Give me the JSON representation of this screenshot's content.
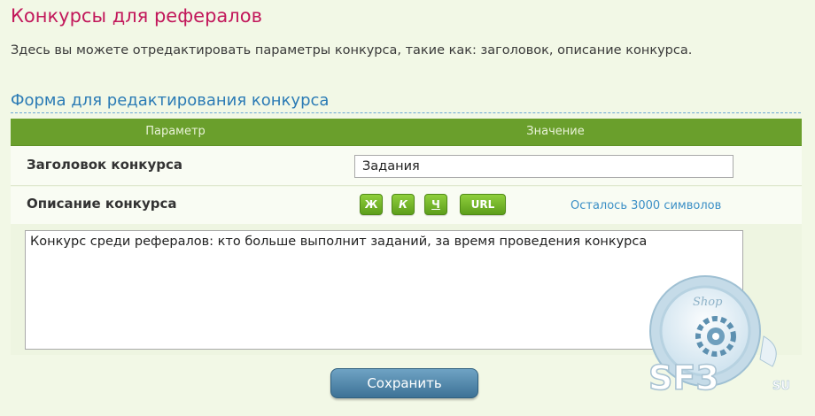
{
  "page": {
    "title": "Конкурсы для рефералов",
    "intro": "Здесь вы можете отредактировать параметры конкурса, такие как: заголовок, описание конкурса."
  },
  "form": {
    "section_title": "Форма для редактирования конкурса",
    "columns": {
      "param": "Параметр",
      "value": "Значение"
    },
    "title_label": "Заголовок конкурса",
    "title_value": "Задания",
    "description_label": "Описание конкурса",
    "format_buttons": {
      "bold": "Ж",
      "italic": "К",
      "underline": "Ч",
      "url": "URL"
    },
    "chars_left": "Осталось 3000 символов",
    "description_value": "Конкурс среди рефералов: кто больше выполнит заданий, за время проведения конкурса",
    "save_label": "Сохранить"
  },
  "watermark": {
    "shop_text": "Shop",
    "brand_text": "SF3",
    "domain_text": "SU"
  },
  "colors": {
    "title": "#c2185b",
    "section_title": "#2b7bb5",
    "header_bg": "#6a9f2c",
    "format_button": "#72b32a",
    "save_button": "#4a80a4",
    "background": "#f2f8e6"
  }
}
